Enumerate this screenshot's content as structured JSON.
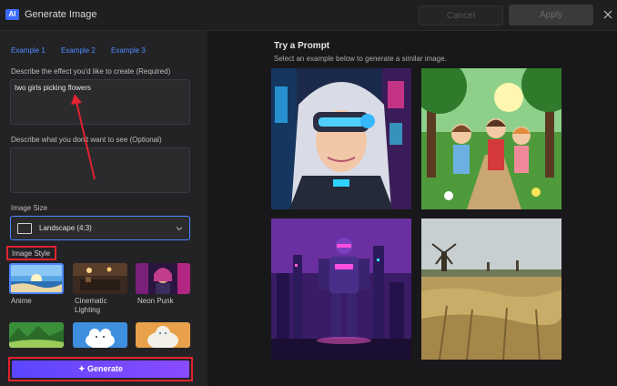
{
  "window": {
    "badge": "AI",
    "title": "Generate Image",
    "cancel_label": "Cancel",
    "apply_label": "Apply",
    "close_icon": "close-icon"
  },
  "examples": [
    "Example 1",
    "Example 2",
    "Example 3"
  ],
  "prompt": {
    "label": "Describe the effect you'd like to create (Required)",
    "value": "two girls picking flowers"
  },
  "negative_prompt": {
    "label": "Describe what you don't want to see (Optional)",
    "value": ""
  },
  "image_size": {
    "label": "Image Size",
    "selected": "Landscape (4:3)"
  },
  "image_style": {
    "label": "Image Style",
    "items": [
      {
        "label": "Anime"
      },
      {
        "label": "Cinematic Lighting"
      },
      {
        "label": "Neon Punk"
      },
      {
        "label": ""
      },
      {
        "label": ""
      },
      {
        "label": ""
      }
    ]
  },
  "generate": {
    "label": "Generate",
    "icon": "sparkle-icon"
  },
  "gallery": {
    "title": "Try a Prompt",
    "subtitle": "Select an example below to generate a similar image."
  },
  "colors": {
    "accent": "#4b86ff",
    "highlight": "#e0232f",
    "generate_start": "#5b46ff",
    "generate_end": "#8a4bff"
  }
}
